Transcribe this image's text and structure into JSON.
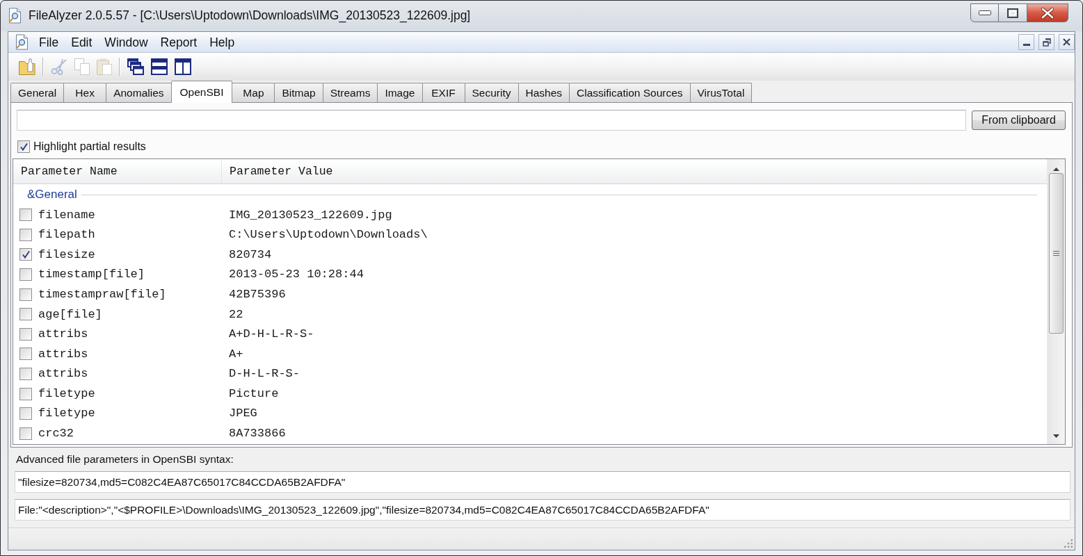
{
  "window": {
    "title": "FileAlyzer 2.0.5.57 - [C:\\Users\\Uptodown\\Downloads\\IMG_20130523_122609.jpg]"
  },
  "menu": [
    "File",
    "Edit",
    "Window",
    "Report",
    "Help"
  ],
  "toolbar": [
    {
      "disabled": false
    },
    {
      "disabled": true
    },
    {
      "disabled": true
    },
    {
      "disabled": true
    },
    {
      "disabled": false
    },
    {
      "disabled": false
    },
    {
      "disabled": false
    }
  ],
  "tabs": [
    {
      "label": "General",
      "selected": false
    },
    {
      "label": "Hex",
      "selected": false
    },
    {
      "label": "Anomalies",
      "selected": false
    },
    {
      "label": "OpenSBI",
      "selected": true
    },
    {
      "label": "Map",
      "selected": false
    },
    {
      "label": "Bitmap",
      "selected": false
    },
    {
      "label": "Streams",
      "selected": false
    },
    {
      "label": "Image",
      "selected": false
    },
    {
      "label": "EXIF",
      "selected": false
    },
    {
      "label": "Security",
      "selected": false
    },
    {
      "label": "Hashes",
      "selected": false
    },
    {
      "label": "Classification Sources",
      "selected": false
    },
    {
      "label": "VirusTotal",
      "selected": false
    }
  ],
  "clipboard_button": "From clipboard",
  "highlight": {
    "label": "Highlight partial results",
    "checked": true
  },
  "table": {
    "columns": [
      "Parameter Name",
      "Parameter Value"
    ],
    "groups": [
      {
        "label": "&General",
        "rows": [
          {
            "name": "filename",
            "value": "IMG_20130523_122609.jpg",
            "checked": false
          },
          {
            "name": "filepath",
            "value": "C:\\Users\\Uptodown\\Downloads\\",
            "checked": false
          },
          {
            "name": "filesize",
            "value": "820734",
            "checked": true
          },
          {
            "name": "timestamp[file]",
            "value": "2013-05-23 10:28:44",
            "checked": false
          },
          {
            "name": "timestampraw[file]",
            "value": "42B75396",
            "checked": false
          },
          {
            "name": "age[file]",
            "value": "22",
            "checked": false
          },
          {
            "name": "attribs",
            "value": "A+D-H-L-R-S-",
            "checked": false
          },
          {
            "name": "attribs",
            "value": "A+",
            "checked": false
          },
          {
            "name": "attribs",
            "value": "D-H-L-R-S-",
            "checked": false
          },
          {
            "name": "filetype",
            "value": "Picture",
            "checked": false
          },
          {
            "name": "filetype",
            "value": "JPEG",
            "checked": false
          },
          {
            "name": "crc32",
            "value": "8A733866",
            "checked": false
          }
        ]
      }
    ]
  },
  "syntax": {
    "label": "Advanced file parameters in OpenSBI syntax:",
    "fields": [
      {
        "value": "\"filesize=820734,md5=C082C4EA87C65017C84CCDA65B2AFDFA\""
      },
      {
        "value": "File:\"<description>\",\"<$PROFILE>\\Downloads\\IMG_20130523_122609.jpg\",\"filesize=820734,md5=C082C4EA87C65017C84CCDA65B2AFDFA\""
      }
    ]
  }
}
